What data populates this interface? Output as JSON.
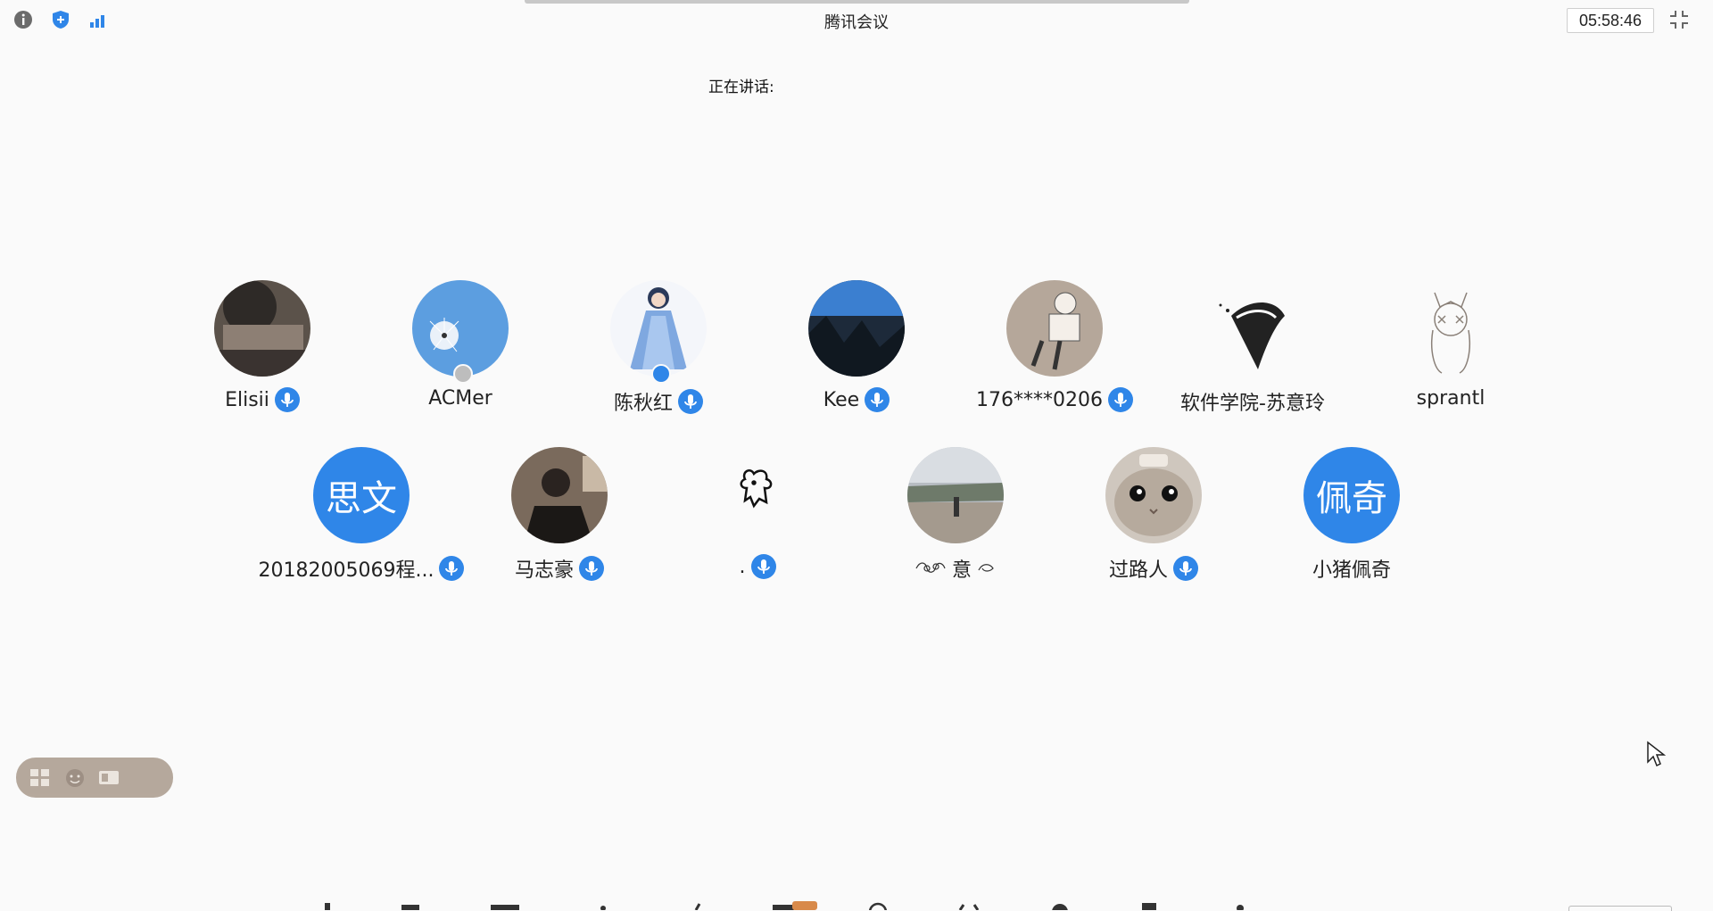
{
  "window": {
    "title": "腾讯会议",
    "timer": "05:58:46"
  },
  "status_icons": [
    "info-icon",
    "shield-icon",
    "signal-icon"
  ],
  "speaking": {
    "label": "正在讲话:"
  },
  "participants": [
    {
      "name": "Elisii",
      "mic": true,
      "avatar_type": "photo"
    },
    {
      "name": "ACMer",
      "mic": false,
      "avatar_type": "photo"
    },
    {
      "name": "陈秋红",
      "mic": true,
      "avatar_type": "photo"
    },
    {
      "name": "Kee",
      "mic": true,
      "avatar_type": "photo"
    },
    {
      "name": "176****0206",
      "mic": true,
      "avatar_type": "photo"
    },
    {
      "name": "软件学院-苏意玲",
      "mic": false,
      "avatar_type": "photo"
    },
    {
      "name": "sprantl",
      "mic": false,
      "avatar_type": "photo"
    },
    {
      "name": "20182005069程...",
      "mic": true,
      "avatar_type": "text",
      "avatar_text": "思文"
    },
    {
      "name": "马志豪",
      "mic": true,
      "avatar_type": "photo"
    },
    {
      "name": ".",
      "mic": true,
      "avatar_type": "photo"
    },
    {
      "name": "意",
      "mic": false,
      "avatar_type": "photo"
    },
    {
      "name": "过路人",
      "mic": true,
      "avatar_type": "photo"
    },
    {
      "name": "小猪佩奇",
      "mic": false,
      "avatar_type": "text",
      "avatar_text": "佩奇"
    }
  ],
  "colors": {
    "accent": "#2f86e8",
    "background": "#fafafa"
  },
  "floating_toolbar_icons": [
    "grid-view-icon",
    "emoji-icon",
    "screen-icon"
  ]
}
